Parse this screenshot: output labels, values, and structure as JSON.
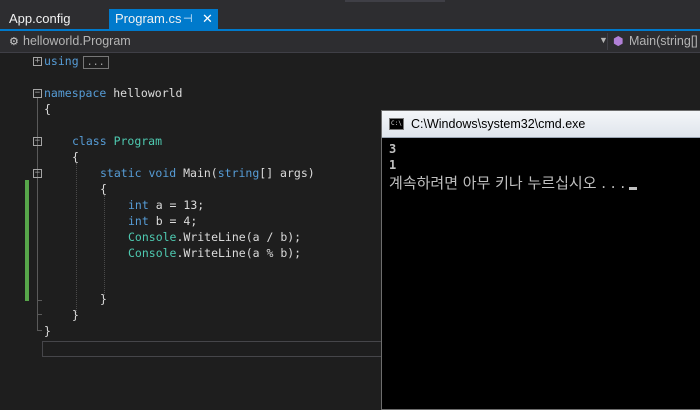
{
  "tabs": [
    {
      "label": "App.config"
    },
    {
      "label": "Program.cs",
      "active": true
    }
  ],
  "tab_icons": {
    "pin": "pin-icon",
    "close": "close-icon"
  },
  "navbar": {
    "left_label": "helloworld.Program",
    "right_label": "Main(string[]",
    "left_icon": "class-icon",
    "right_icon": "method-icon"
  },
  "code": {
    "using_kw": "using",
    "using_collapsed": "...",
    "namespace_kw": "namespace",
    "namespace_name": " helloworld",
    "brace_open": "{",
    "brace_close": "}",
    "class_kw": "class",
    "class_name": "Program",
    "static_kw": "static",
    "void_kw": "void",
    "main_sig_a": " Main(",
    "string_kw": "string",
    "main_sig_b": "[] args)",
    "int_kw": "int",
    "line_a": " a = 13;",
    "line_b": " b = 4;",
    "console_type": "Console",
    "writeline_1": ".WriteLine(a / b);",
    "writeline_2": ".WriteLine(a % b);"
  },
  "console": {
    "title": "C:\\Windows\\system32\\cmd.exe",
    "icon_text": "C:\\",
    "output": [
      "3",
      "1"
    ],
    "prompt": "계속하려면 아무 키나 누르십시오 . . ."
  },
  "colors": {
    "accent": "#007acc",
    "keyword": "#569cd6",
    "type": "#4ec9b0",
    "change": "#57a64a"
  }
}
